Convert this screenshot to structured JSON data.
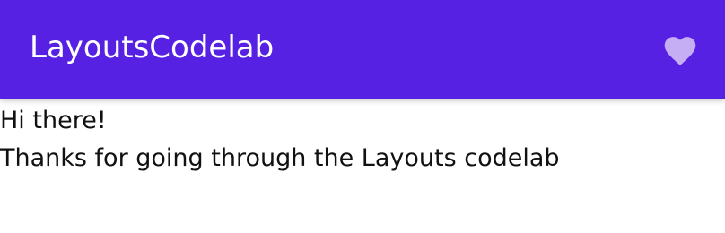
{
  "app_bar": {
    "title": "LayoutsCodelab",
    "background": "#5721E3",
    "action_icon": "heart-icon",
    "action_icon_color": "#C6AEF4"
  },
  "content": {
    "greeting": "Hi there!",
    "message": "Thanks for going through the Layouts codelab"
  }
}
